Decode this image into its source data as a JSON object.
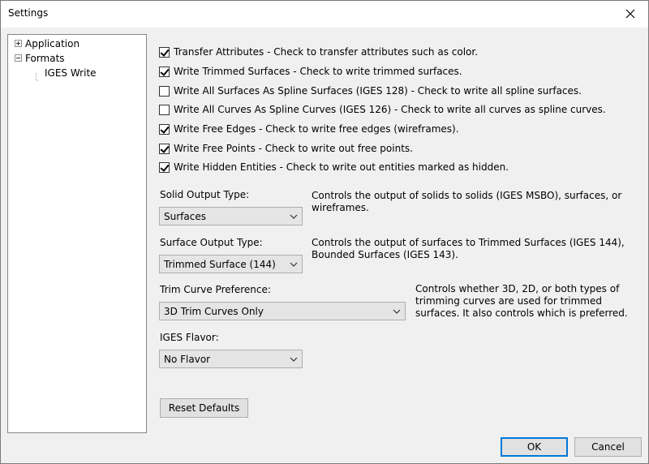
{
  "window": {
    "title": "Settings"
  },
  "tree": [
    {
      "label": "Application",
      "expander": "plus"
    },
    {
      "label": "Formats",
      "expander": "minus"
    },
    {
      "label": "IGES Write"
    }
  ],
  "checkboxes": [
    {
      "label": "Transfer Attributes - Check to transfer attributes such as color.",
      "checked": true
    },
    {
      "label": "Write Trimmed Surfaces - Check to write trimmed surfaces.",
      "checked": true
    },
    {
      "label": "Write All Surfaces As Spline Surfaces (IGES 128) - Check to write all spline surfaces.",
      "checked": false
    },
    {
      "label": "Write All Curves As Spline Curves (IGES 126) - Check to write all curves as spline curves.",
      "checked": false
    },
    {
      "label": "Write Free Edges - Check to write free edges (wireframes).",
      "checked": true
    },
    {
      "label": "Write Free Points - Check to write out free points.",
      "checked": true
    },
    {
      "label": "Write Hidden Entities - Check to write out entities marked as hidden.",
      "checked": true
    }
  ],
  "options": {
    "solid": {
      "label": "Solid Output Type:",
      "value": "Surfaces",
      "description": "Controls the output of solids to solids (IGES MSBO), surfaces, or wireframes."
    },
    "surface": {
      "label": "Surface Output Type:",
      "value": "Trimmed Surface (144)",
      "description": "Controls the output of surfaces to Trimmed Surfaces (IGES 144), Bounded Surfaces (IGES 143)."
    },
    "trim": {
      "label": "Trim Curve Preference:",
      "value": "3D Trim Curves Only",
      "description": "Controls whether 3D, 2D, or both types of trimming curves are used for trimmed surfaces.  It also controls which is preferred."
    },
    "flavor": {
      "label": "IGES Flavor:",
      "value": "No Flavor"
    }
  },
  "buttons": {
    "reset": "Reset Defaults",
    "ok": "OK",
    "cancel": "Cancel"
  }
}
